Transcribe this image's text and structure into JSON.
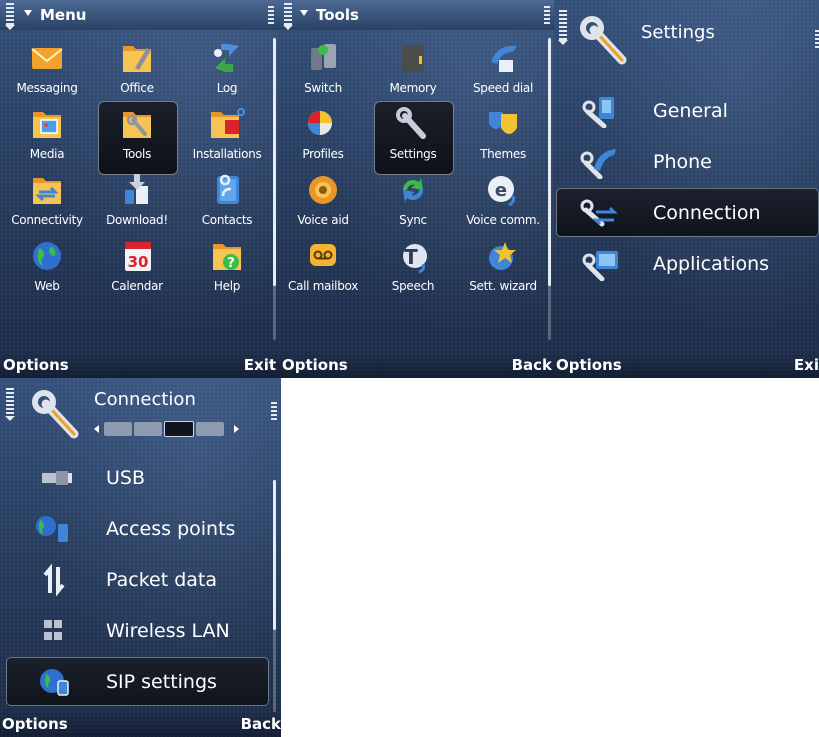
{
  "menu_screen": {
    "title": "Menu",
    "items": [
      {
        "label": "Messaging",
        "icon": "envelope-icon"
      },
      {
        "label": "Office",
        "icon": "office-folder-icon"
      },
      {
        "label": "Log",
        "icon": "log-arrows-icon"
      },
      {
        "label": "Media",
        "icon": "media-folder-icon"
      },
      {
        "label": "Tools",
        "icon": "tools-folder-icon"
      },
      {
        "label": "Installations",
        "icon": "installations-folder-icon"
      },
      {
        "label": "Connectivity",
        "icon": "connectivity-folder-icon"
      },
      {
        "label": "Download!",
        "icon": "download-icon"
      },
      {
        "label": "Contacts",
        "icon": "contacts-icon"
      },
      {
        "label": "Web",
        "icon": "globe-icon"
      },
      {
        "label": "Calendar",
        "icon": "calendar-icon"
      },
      {
        "label": "Help",
        "icon": "help-icon"
      }
    ],
    "calendar_day": "30",
    "softkey_left": "Options",
    "softkey_right": "Exit"
  },
  "tools_screen": {
    "title": "Tools",
    "items": [
      {
        "label": "Switch",
        "icon": "switch-icon"
      },
      {
        "label": "Memory",
        "icon": "memory-card-icon"
      },
      {
        "label": "Speed dial",
        "icon": "speed-dial-icon"
      },
      {
        "label": "Profiles",
        "icon": "profiles-icon"
      },
      {
        "label": "Settings",
        "icon": "wrench-icon"
      },
      {
        "label": "Themes",
        "icon": "themes-mask-icon"
      },
      {
        "label": "Voice aid",
        "icon": "speaker-icon"
      },
      {
        "label": "Sync",
        "icon": "sync-icon"
      },
      {
        "label": "Voice comm.",
        "icon": "voice-comm-icon"
      },
      {
        "label": "Call mailbox",
        "icon": "voicemail-icon"
      },
      {
        "label": "Speech",
        "icon": "speech-icon"
      },
      {
        "label": "Sett. wizard",
        "icon": "wizard-star-icon"
      }
    ],
    "softkey_left": "Options",
    "softkey_right": "Back"
  },
  "settings_screen": {
    "title": "Settings",
    "items": [
      {
        "label": "General",
        "icon": "general-settings-icon"
      },
      {
        "label": "Phone",
        "icon": "phone-settings-icon"
      },
      {
        "label": "Connection",
        "icon": "connection-settings-icon"
      },
      {
        "label": "Applications",
        "icon": "applications-settings-icon"
      }
    ],
    "softkey_left": "Options",
    "softkey_right": "Exi"
  },
  "connection_screen": {
    "title": "Connection",
    "items": [
      {
        "label": "USB",
        "icon": "usb-icon"
      },
      {
        "label": "Access points",
        "icon": "access-points-icon"
      },
      {
        "label": "Packet data",
        "icon": "packet-data-icon"
      },
      {
        "label": "Wireless LAN",
        "icon": "wireless-lan-icon"
      },
      {
        "label": "SIP settings",
        "icon": "sip-settings-icon"
      }
    ],
    "softkey_left": "Options",
    "softkey_right": "Back"
  },
  "colors": {
    "background_top": "#34507a",
    "background_bottom": "#1c2c47",
    "selection": "#0f131c",
    "text": "#ffffff",
    "folder": "#f0a830"
  }
}
